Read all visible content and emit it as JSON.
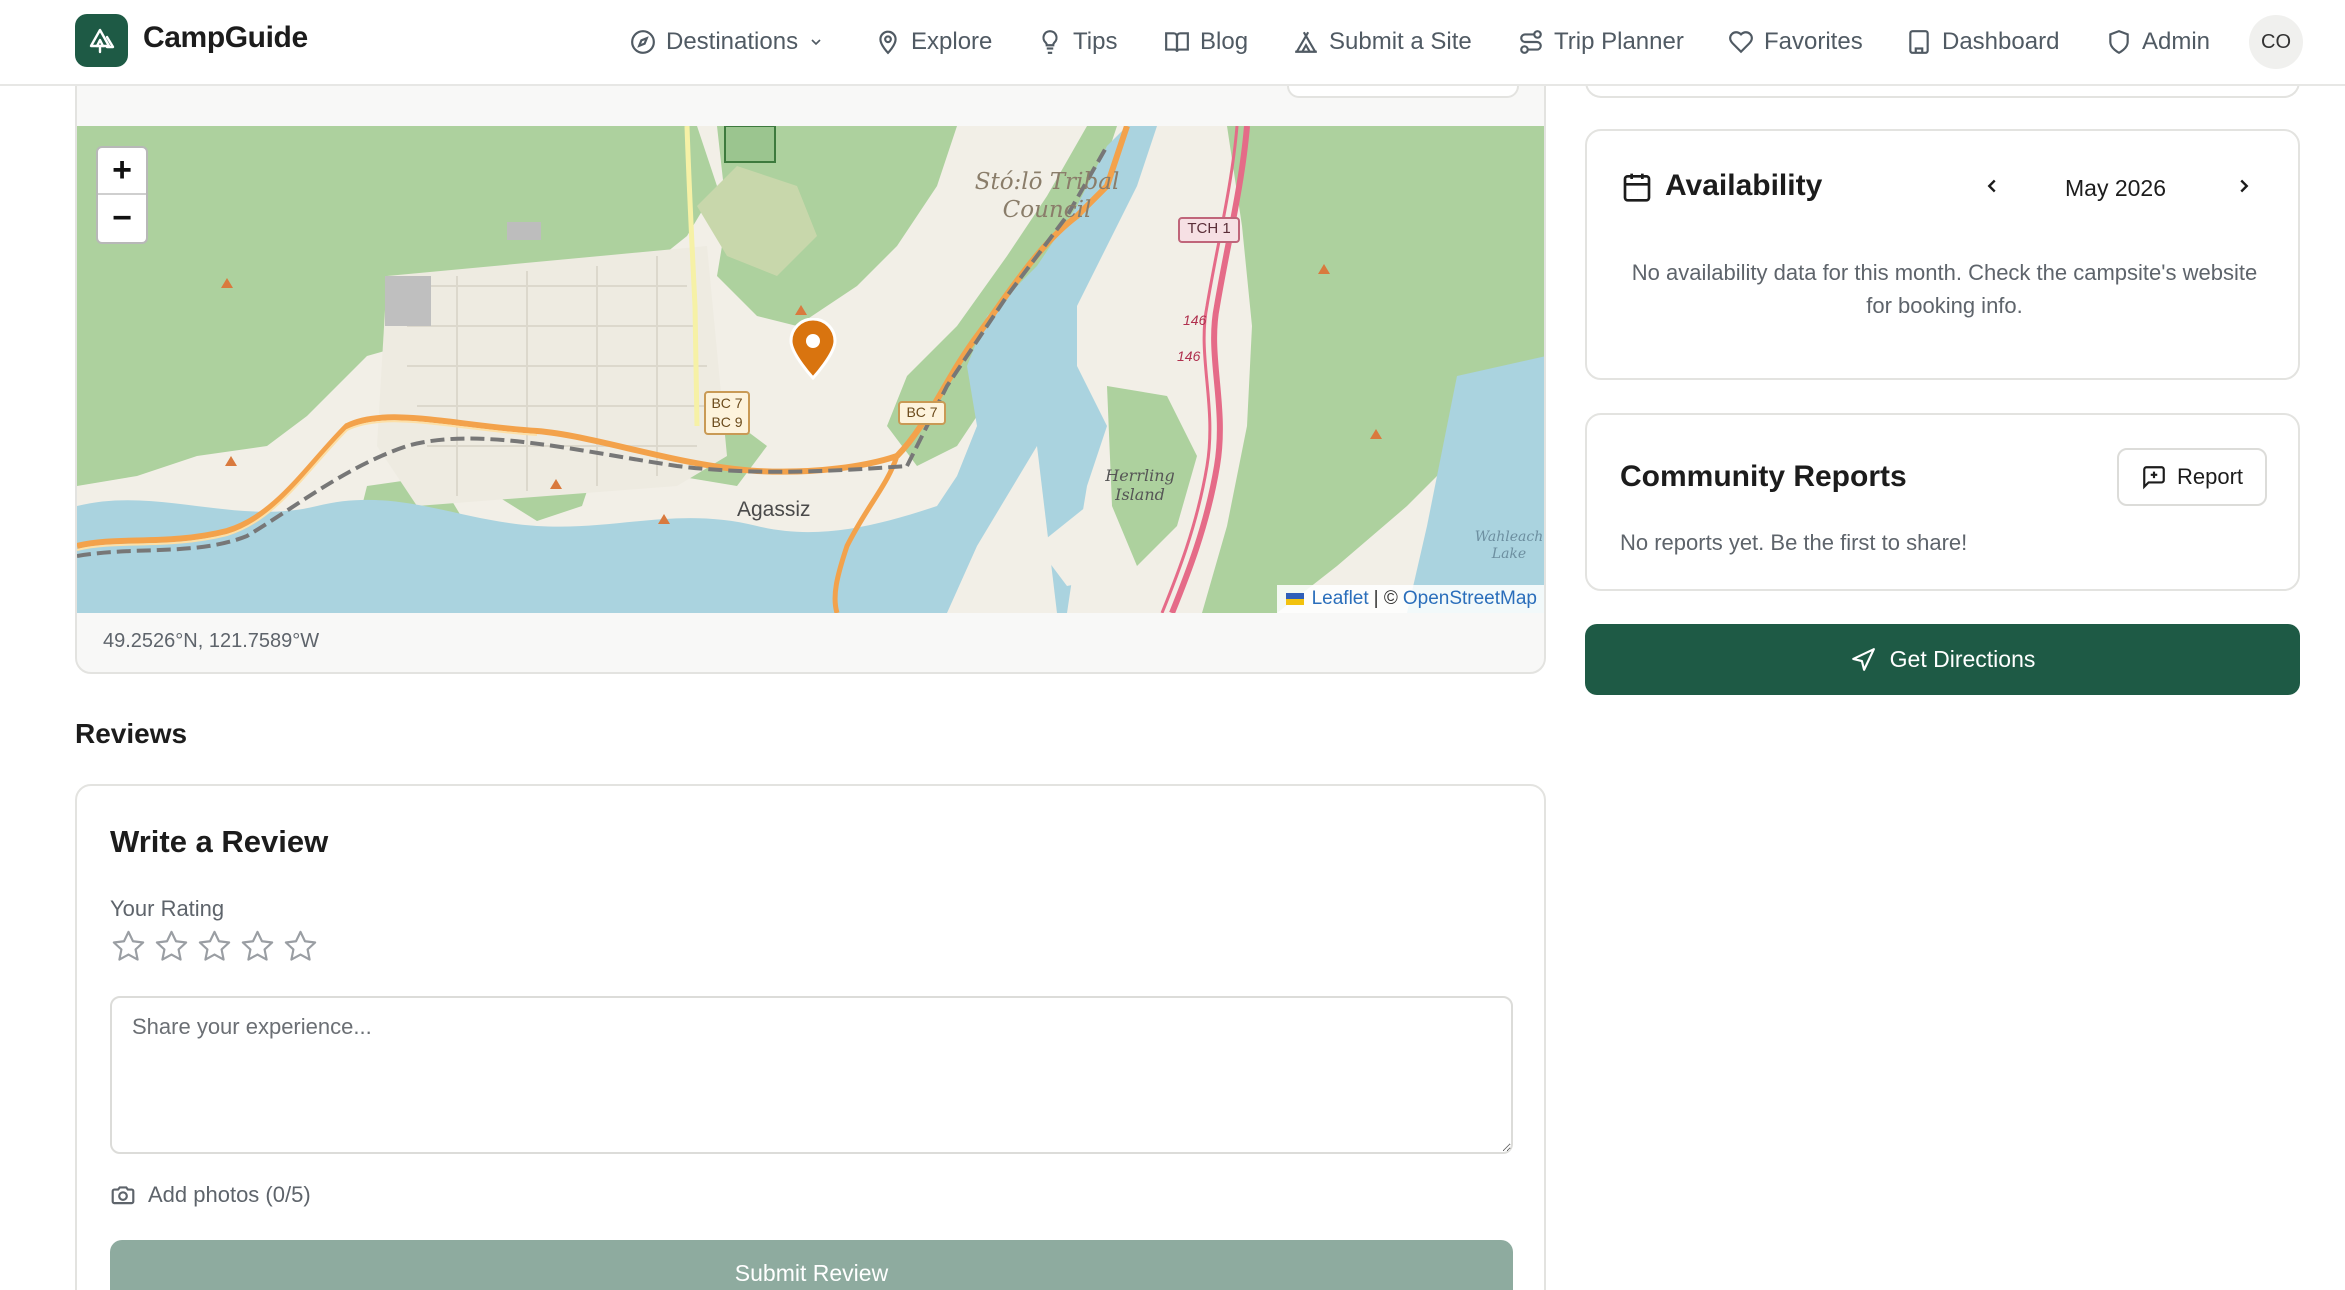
{
  "header": {
    "brand": "CampGuide",
    "nav": {
      "destinations": "Destinations",
      "explore": "Explore",
      "tips": "Tips",
      "blog": "Blog",
      "submit_site": "Submit a Site",
      "trip_planner": "Trip Planner",
      "favorites": "Favorites",
      "dashboard": "Dashboard",
      "admin": "Admin"
    },
    "avatar_initials": "CO"
  },
  "map": {
    "zoom_in": "+",
    "zoom_out": "−",
    "labels": {
      "town": "Agassiz",
      "tribal_1": "Stó:lō Tribal",
      "tribal_2": "Council",
      "island_1": "Herrling",
      "island_2": "Island",
      "lake_1": "Wahleach",
      "lake_2": "Lake",
      "shield_tch1": "TCH 1",
      "shield_bc7": "BC 7",
      "shield_bc7b": "BC 7",
      "shield_bc9": "BC 9",
      "hwy_146_a": "146",
      "hwy_146_b": "146"
    },
    "attribution": {
      "leaflet": "Leaflet",
      "separator": "| ©",
      "osm": "OpenStreetMap"
    },
    "coordinates": "49.2526°N, 121.7589°W"
  },
  "reviews": {
    "heading": "Reviews",
    "form_title": "Write a Review",
    "rating_label": "Your Rating",
    "rating_value": 0,
    "rating_max": 5,
    "placeholder": "Share your experience...",
    "add_photos": "Add photos (0/5)",
    "submit": "Submit Review"
  },
  "availability": {
    "title": "Availability",
    "month": "May 2026",
    "message": "No availability data for this month. Check the campsite's website for booking info."
  },
  "community": {
    "title": "Community Reports",
    "report_button": "Report",
    "message": "No reports yet. Be the first to share!"
  },
  "directions": {
    "label": "Get Directions"
  },
  "colors": {
    "brand_green": "#1e5a45",
    "submit_disabled": "#8eab9f",
    "marker_orange": "#d9740f",
    "map_forest": "#add19e",
    "map_water": "#aad3df"
  },
  "icons": {
    "logo": "tent-tree-icon",
    "destinations": "compass-icon",
    "explore": "map-pin-icon",
    "tips": "lightbulb-icon",
    "blog": "book-open-icon",
    "submit_site": "tent-icon",
    "trip_planner": "route-icon",
    "favorites": "heart-icon",
    "dashboard": "building-icon",
    "admin": "shield-icon"
  }
}
